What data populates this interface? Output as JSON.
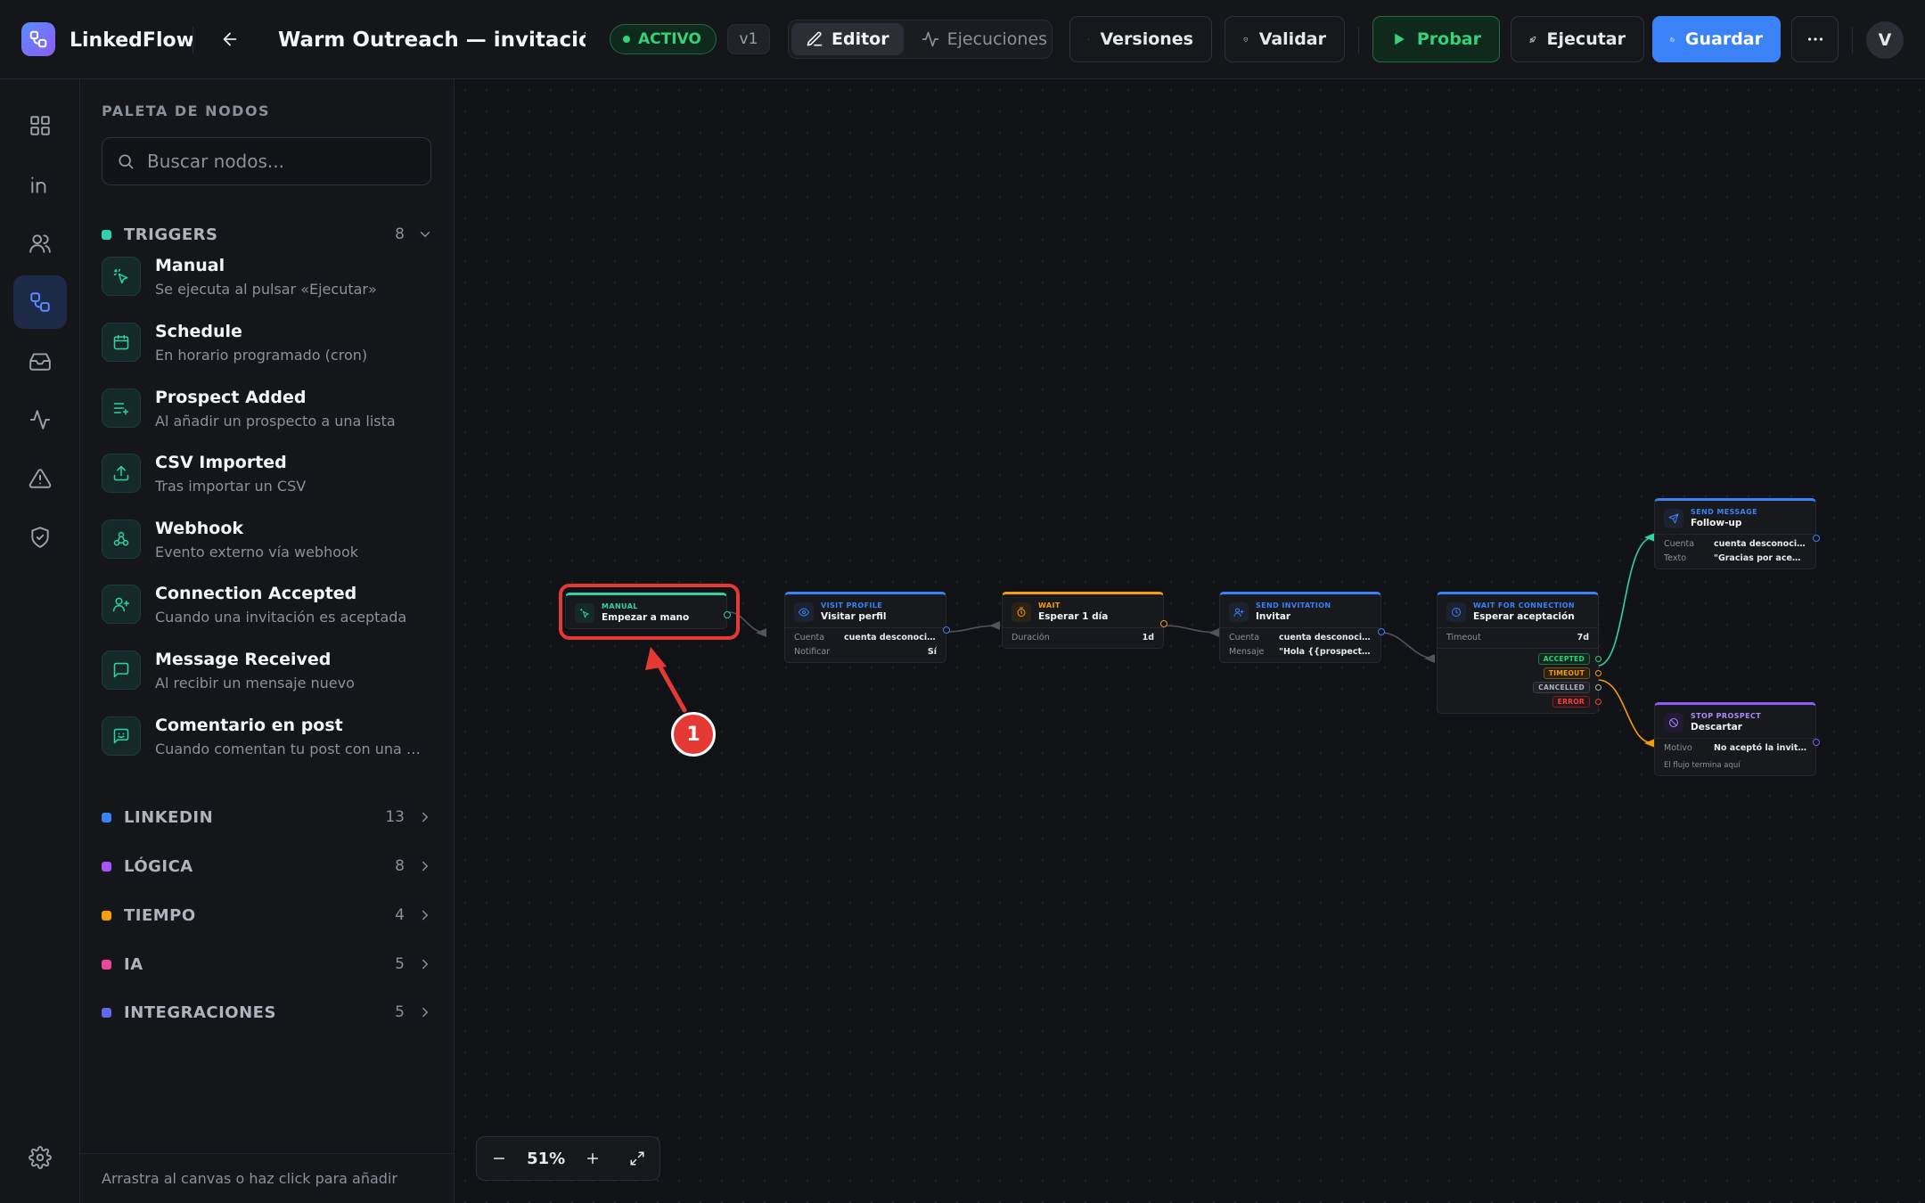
{
  "app": {
    "name": "LinkedFlow"
  },
  "flow": {
    "title": "Warm Outreach — invitación + fol",
    "status": "ACTIVO",
    "version": "v1"
  },
  "toolbar": {
    "editor_label": "Editor",
    "runs_label": "Ejecuciones",
    "versions_label": "Versiones",
    "validate_label": "Validar",
    "test_label": "Probar",
    "run_label": "Ejecutar",
    "save_label": "Guardar",
    "avatar_initial": "V"
  },
  "colors": {
    "accent": "#3b82f6",
    "green": "#34d27a",
    "orange": "#f59e0b",
    "purple": "#8b5cf6",
    "annotation": "#e53935"
  },
  "rail": {
    "items": [
      "dashboard-icon",
      "linkedin-icon",
      "users-icon",
      "workflow-icon",
      "inbox-icon",
      "activity-icon",
      "alert-icon",
      "shield-icon",
      "settings-icon"
    ],
    "active": "workflow-icon"
  },
  "palette": {
    "title": "PALETA DE NODOS",
    "search_placeholder": "Buscar nodos...",
    "footer": "Arrastra al canvas o haz click para añadir",
    "categories": [
      {
        "name": "TRIGGERS",
        "count": "8",
        "color": "#2dd4a7",
        "expanded": true
      },
      {
        "name": "LINKEDIN",
        "count": "13",
        "color": "#3b82f6"
      },
      {
        "name": "LÓGICA",
        "count": "8",
        "color": "#a855f7"
      },
      {
        "name": "TIEMPO",
        "count": "4",
        "color": "#f59e0b"
      },
      {
        "name": "IA",
        "count": "5",
        "color": "#ec4899"
      },
      {
        "name": "INTEGRACIONES",
        "count": "5",
        "color": "#6366f1"
      }
    ],
    "triggers": [
      {
        "name": "Manual",
        "desc": "Se ejecuta al pulsar «Ejecutar»",
        "icon": "pointer-icon"
      },
      {
        "name": "Schedule",
        "desc": "En horario programado (cron)",
        "icon": "calendar-icon"
      },
      {
        "name": "Prospect Added",
        "desc": "Al añadir un prospecto a una lista",
        "icon": "list-plus-icon"
      },
      {
        "name": "CSV Imported",
        "desc": "Tras importar un CSV",
        "icon": "upload-icon"
      },
      {
        "name": "Webhook",
        "desc": "Evento externo vía webhook",
        "icon": "webhook-icon"
      },
      {
        "name": "Connection Accepted",
        "desc": "Cuando una invitación es aceptada",
        "icon": "user-plus-icon"
      },
      {
        "name": "Message Received",
        "desc": "Al recibir un mensaje nuevo",
        "icon": "message-icon"
      },
      {
        "name": "Comentario en post",
        "desc": "Cuando comentan tu post con una palabra clave",
        "icon": "comment-icon"
      }
    ]
  },
  "canvas": {
    "zoom": "51%",
    "nodes": {
      "manual": {
        "type": "MANUAL",
        "name": "Empezar a mano"
      },
      "visit": {
        "type": "VISIT PROFILE",
        "name": "Visitar perfil",
        "rows": [
          {
            "k": "Cuenta",
            "v": "cuenta desconocida"
          },
          {
            "k": "Notificar",
            "v": "Sí"
          }
        ]
      },
      "wait": {
        "type": "WAIT",
        "name": "Esperar 1 día",
        "rows": [
          {
            "k": "Duración",
            "v": "1d"
          }
        ]
      },
      "invite": {
        "type": "SEND INVITATION",
        "name": "Invitar",
        "rows": [
          {
            "k": "Cuenta",
            "v": "cuenta desconocida"
          },
          {
            "k": "Mensaje",
            "v": "\"Hola {{prospect.first..."
          }
        ]
      },
      "waitconn": {
        "type": "WAIT FOR CONNECTION",
        "name": "Esperar aceptación",
        "rows": [
          {
            "k": "Timeout",
            "v": "7d"
          }
        ],
        "outcomes": [
          "ACCEPTED",
          "TIMEOUT",
          "CANCELLED",
          "ERROR"
        ]
      },
      "message": {
        "type": "SEND MESSAGE",
        "name": "Follow-up",
        "rows": [
          {
            "k": "Cuenta",
            "v": "cuenta desconocida"
          },
          {
            "k": "Texto",
            "v": "\"Gracias por aceptar, {{..."
          }
        ]
      },
      "stop": {
        "type": "STOP PROSPECT",
        "name": "Descartar",
        "rows": [
          {
            "k": "Motivo",
            "v": "No aceptó la invitación..."
          }
        ],
        "note": "El flujo termina aquí"
      }
    }
  },
  "annotation": {
    "label": "1"
  }
}
